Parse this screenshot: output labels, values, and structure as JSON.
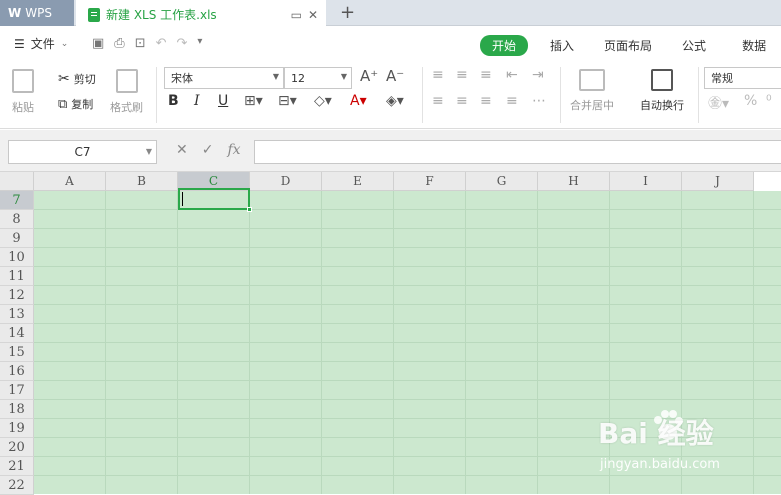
{
  "app": {
    "brand": "WPS"
  },
  "document_tab": {
    "title": "新建 XLS 工作表.xls"
  },
  "menu": {
    "file_label": "文件"
  },
  "ribbon_tabs": [
    {
      "label": "开始",
      "active": true
    },
    {
      "label": "插入",
      "active": false
    },
    {
      "label": "页面布局",
      "active": false
    },
    {
      "label": "公式",
      "active": false
    },
    {
      "label": "数据",
      "active": false
    }
  ],
  "ribbon": {
    "paste_label": "粘贴",
    "cut_label": "剪切",
    "copy_label": "复制",
    "format_painter_label": "格式刷",
    "font_name": "宋体",
    "font_size": "12",
    "merge_center_label": "合并居中",
    "wrap_text_label": "自动换行",
    "number_format": "常规"
  },
  "formula_bar": {
    "cell_ref": "C7",
    "fx_label": "fx",
    "value": ""
  },
  "sheet": {
    "columns": [
      "A",
      "B",
      "C",
      "D",
      "E",
      "F",
      "G",
      "H",
      "I",
      "J"
    ],
    "rows": [
      "7",
      "8",
      "9",
      "10",
      "11",
      "12",
      "13",
      "14",
      "15",
      "16",
      "17",
      "18",
      "19",
      "20",
      "21",
      "22"
    ],
    "selected_column": "C",
    "selected_row": "7"
  },
  "watermark": {
    "main": "Bai 经验",
    "sub": "jingyan.baidu.com"
  },
  "colors": {
    "accent": "#2aa84a",
    "cell_bg": "#cce8cf"
  }
}
